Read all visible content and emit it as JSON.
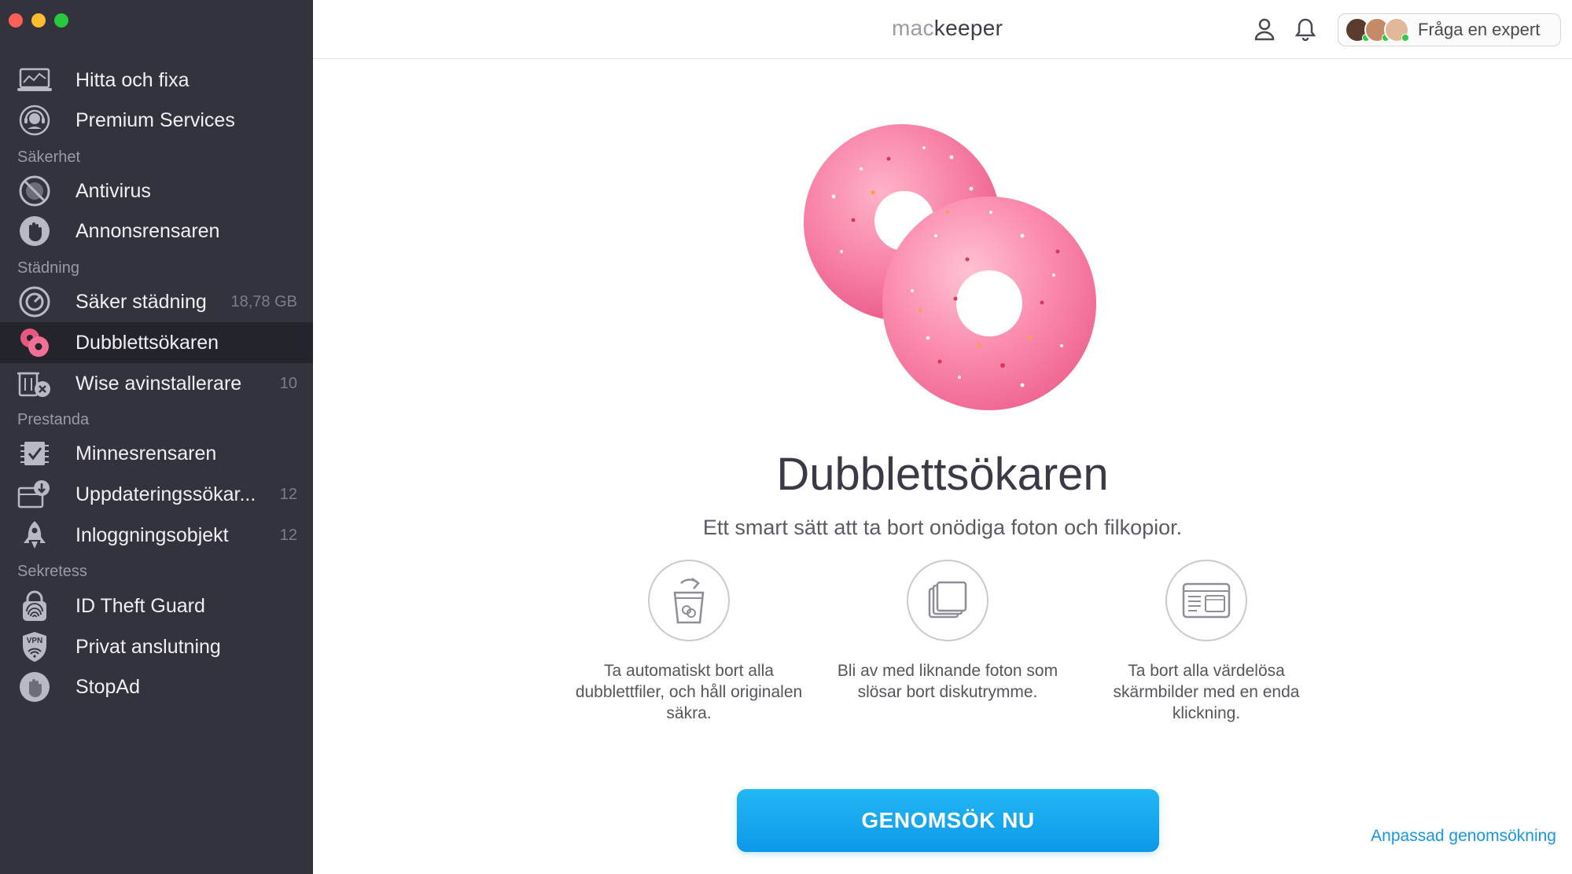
{
  "app": {
    "logo_mac": "mac",
    "logo_keeper": "keeper"
  },
  "sidebar": {
    "items": [
      {
        "label": "Hitta och fixa",
        "icon": "laptop-icon"
      },
      {
        "label": "Premium Services",
        "icon": "support-icon"
      }
    ],
    "sections": [
      {
        "title": "Säkerhet",
        "items": [
          {
            "label": "Antivirus",
            "icon": "shield-no-icon"
          },
          {
            "label": "Annonsrensaren",
            "icon": "hand-icon"
          }
        ]
      },
      {
        "title": "Städning",
        "items": [
          {
            "label": "Säker städning",
            "count": "18,78 GB",
            "icon": "disk-icon"
          },
          {
            "label": "Dubblettsökaren",
            "icon": "donut-icon",
            "active": true
          },
          {
            "label": "Wise avinstallerare",
            "count": "10",
            "icon": "uninstall-icon"
          }
        ]
      },
      {
        "title": "Prestanda",
        "items": [
          {
            "label": "Minnesrensaren",
            "icon": "memory-icon"
          },
          {
            "label": "Uppdateringssökar...",
            "count": "12",
            "icon": "update-icon"
          },
          {
            "label": "Inloggningsobjekt",
            "count": "12",
            "icon": "rocket-icon"
          }
        ]
      },
      {
        "title": "Sekretess",
        "items": [
          {
            "label": "ID Theft Guard",
            "icon": "fingerprint-lock-icon"
          },
          {
            "label": "Privat anslutning",
            "icon": "vpn-icon"
          },
          {
            "label": "StopAd",
            "icon": "stop-hand-icon"
          }
        ]
      }
    ]
  },
  "header": {
    "expert_label": "Fråga en expert"
  },
  "main": {
    "title": "Dubblettsökaren",
    "subtitle": "Ett smart sätt att ta bort onödiga foton och filkopior.",
    "features": [
      {
        "text": "Ta automatiskt bort alla dubblettfiler, och håll originalen säkra.",
        "icon": "trash-duplicate-icon"
      },
      {
        "text": "Bli av med liknande foton som slösar bort diskutrymme.",
        "icon": "similar-photos-icon"
      },
      {
        "text": "Ta bort alla värdelösa skärmbilder med en enda klickning.",
        "icon": "screenshot-icon"
      }
    ],
    "scan_button": "GENOMSÖK NU",
    "custom_scan_link": "Anpassad genomsökning"
  },
  "colors": {
    "sidebar_bg": "#33333d",
    "sidebar_active": "#24242c",
    "accent": "#1a96de",
    "donut_pink": "#f47ca3"
  }
}
